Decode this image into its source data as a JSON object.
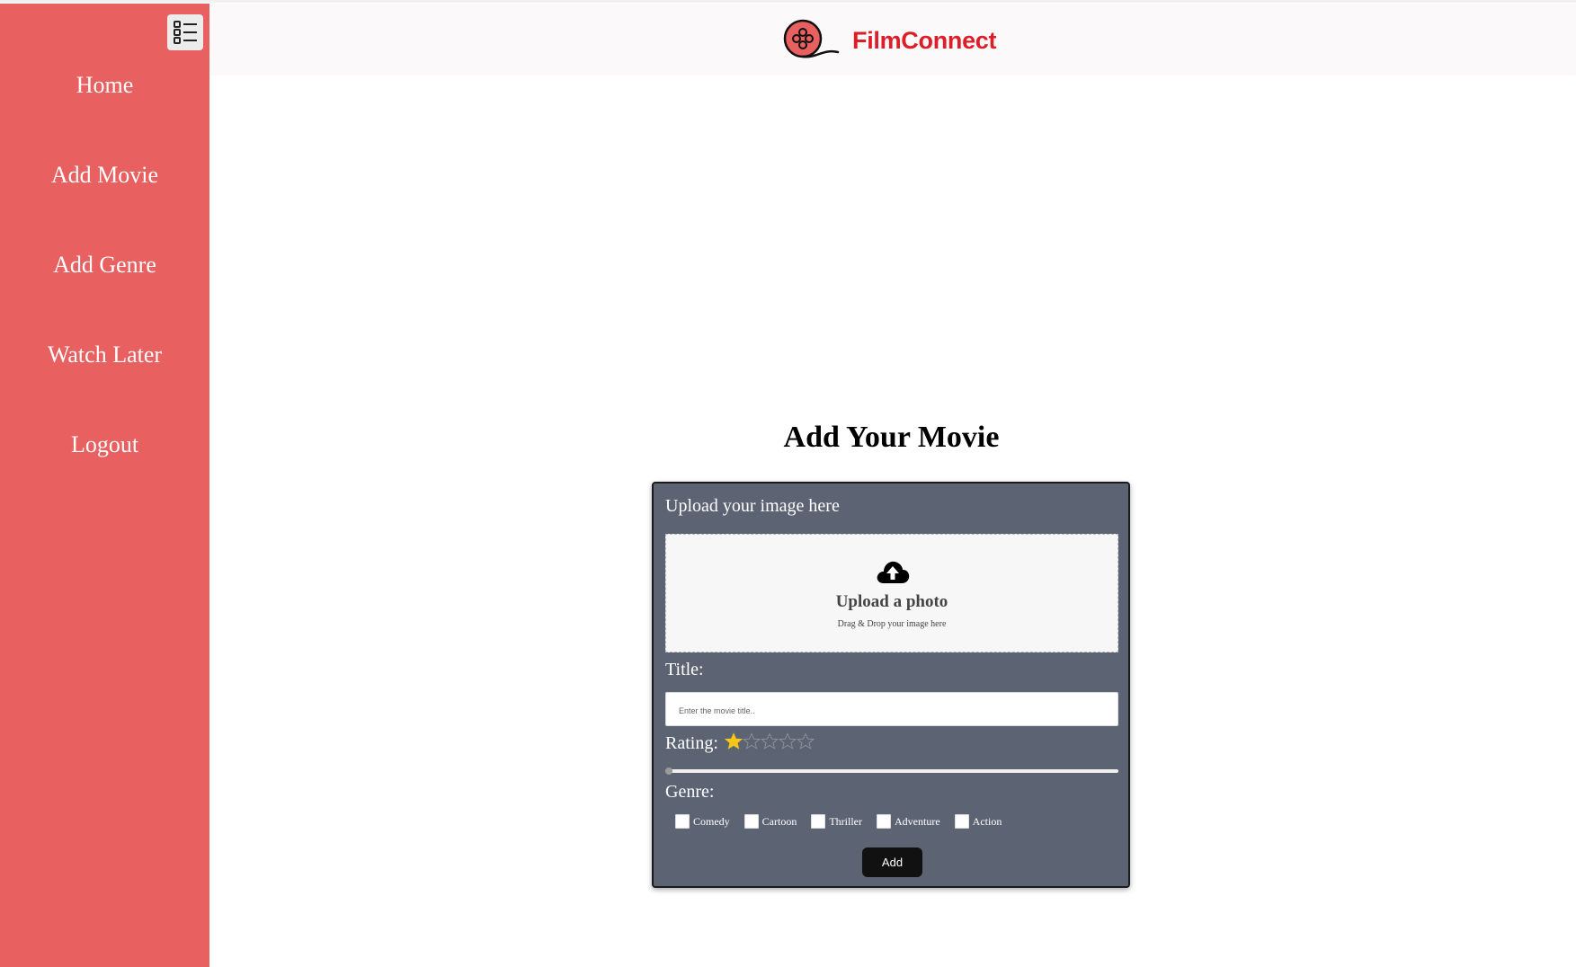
{
  "app": {
    "brand_name": "FilmConnect"
  },
  "sidebar": {
    "items": [
      {
        "label": "Home"
      },
      {
        "label": "Add Movie"
      },
      {
        "label": "Add Genre"
      },
      {
        "label": "Watch Later"
      },
      {
        "label": "Logout"
      }
    ]
  },
  "main": {
    "title": "Add Your Movie",
    "form": {
      "upload_label": "Upload your image here",
      "dropzone_title": "Upload a photo",
      "dropzone_subtitle": "Drag & Drop your image here",
      "title_label": "Title:",
      "title_placeholder": "Enter the movie title..",
      "title_value": "",
      "rating_label": "Rating:",
      "rating": {
        "value": 1,
        "max": 5
      },
      "slider_fraction": 0,
      "genre_label": "Genre:",
      "genres": [
        {
          "label": "Comedy",
          "checked": false
        },
        {
          "label": "Cartoon",
          "checked": false
        },
        {
          "label": "Thriller",
          "checked": false
        },
        {
          "label": "Adventure",
          "checked": false
        },
        {
          "label": "Action",
          "checked": false
        }
      ],
      "submit_label": "Add"
    }
  },
  "colors": {
    "sidebar": "#e86060",
    "brand": "#dc1e28",
    "card": "#5c6474",
    "star_filled": "#f5c518",
    "button": "#111111"
  },
  "icons": [
    "menu-list-icon",
    "film-reel-logo-icon",
    "cloud-upload-icon",
    "star-icon",
    "checkbox-icon"
  ]
}
